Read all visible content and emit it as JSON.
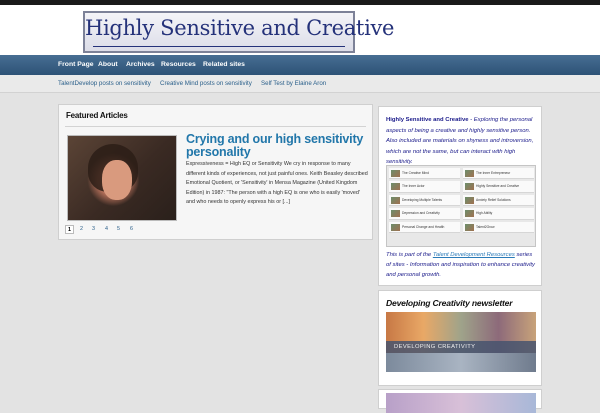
{
  "header": {
    "site_title": "Highly Sensitive and Creative"
  },
  "nav": {
    "items": [
      "Front Page",
      "About",
      "Archives",
      "Resources",
      "Related sites"
    ]
  },
  "subnav": {
    "items": [
      "TalentDevelop posts on sensitivity",
      "Creative Mind posts on sensitivity",
      "Self Test by Elaine Aron"
    ]
  },
  "featured": {
    "heading": "Featured Articles",
    "article_title": "Crying and our high sensitivity personality",
    "excerpt": "Expressiveness = High EQ or Sensitivity We cry in response to many different kinds of experiences, not just painful ones. Keith Beasley described Emotional Quotient, or 'Sensitivity' in Mensa Magazine (United Kingdom Edition) in 1987: \"The person with a high EQ is one who is easily 'moved' and who needs to openly express his or [...]",
    "pages": [
      "1",
      "2",
      "3",
      "4",
      "5",
      "6"
    ],
    "active_page": "1"
  },
  "sidebar": {
    "intro_strong": "Highly Sensitive and Creative",
    "intro_rest": " - Exploring the personal aspects of being a creative and highly sensitive person. Also included are materials on shyness and introversion, which are not the same, but can interact with high sensitivity.",
    "collage_items": [
      "The Creative Mind",
      "The Inner Entrepreneur",
      "The Inner Actor",
      "Highly Sensitive and Creative",
      "Developing Multiple Talents",
      "Anxiety Relief Solutions",
      "Depression and Creativity",
      "High Ability",
      "Personal Change and Health",
      "Talent2Grow"
    ],
    "part_of_prefix": "This is part of the ",
    "part_of_link": "Talent Development Resources",
    "part_of_suffix": " series of sites - Information and inspiration to enhance creativity and personal growth.",
    "newsletter_title": "Developing Creativity newsletter",
    "newsletter_banner": "DEVELOPING CREATIVITY"
  },
  "colors": {
    "nav_bg": "#2d5276",
    "link": "#2277aa",
    "logo_text": "#25327a"
  }
}
